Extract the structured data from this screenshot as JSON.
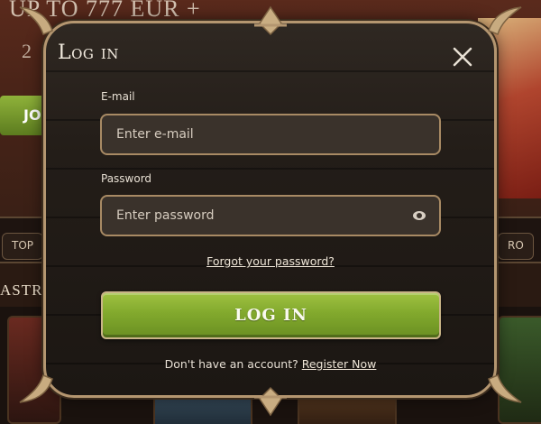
{
  "background": {
    "promo_text": "UP TO 777 EUR +",
    "promo_number": "2",
    "join_label": "JO",
    "tab_left": "TOP",
    "tab_right": "RO",
    "section_title": "ASTRIA"
  },
  "modal": {
    "title": "Log in",
    "email": {
      "label": "E-mail",
      "placeholder": "Enter e-mail",
      "value": ""
    },
    "password": {
      "label": "Password",
      "placeholder": "Enter password",
      "value": ""
    },
    "forgot_label": "Forgot your password?",
    "login_label": "LOG IN",
    "register_prompt": "Don't have an account?",
    "register_label": "Register Now"
  },
  "icons": {
    "close": "close-icon",
    "eye": "eye-icon"
  },
  "colors": {
    "accent_green": "#8bb033",
    "border_gold": "#b49670",
    "modal_bg": "#231d18"
  }
}
